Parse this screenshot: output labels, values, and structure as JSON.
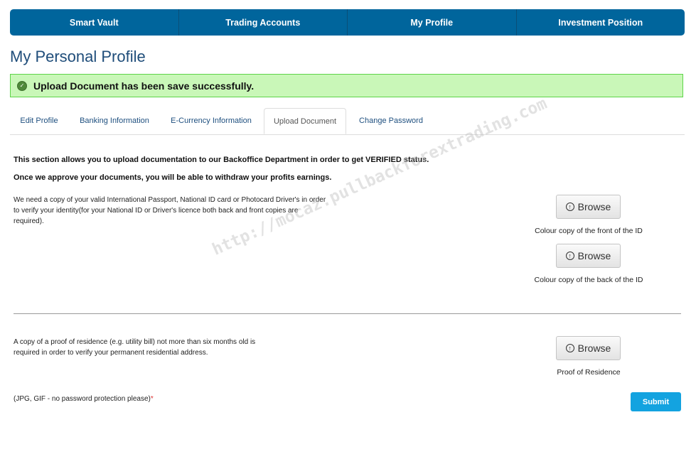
{
  "nav": {
    "items": [
      {
        "label": "Smart Vault"
      },
      {
        "label": "Trading Accounts"
      },
      {
        "label": "My Profile"
      },
      {
        "label": "Investment Position"
      }
    ]
  },
  "page": {
    "title": "My Personal Profile"
  },
  "alert": {
    "message": "Upload Document has been save successfully.",
    "icon": "check-circle-icon",
    "color": "#c9f7b8"
  },
  "tabs": [
    {
      "label": "Edit Profile"
    },
    {
      "label": "Banking Information"
    },
    {
      "label": "E-Currency Information"
    },
    {
      "label": "Upload Document",
      "active": true
    },
    {
      "label": "Change Password"
    }
  ],
  "content": {
    "intro_1": "This section allows you to upload documentation to our Backoffice Department in order to get VERIFIED status.",
    "intro_2": "Once we approve your documents, you will be able to withdraw your profits earnings.",
    "id_description": "We need a copy of your valid International Passport, National ID card or Photocard Driver's in order to verify your identity(for your National ID or Driver's licence both back and front copies are required).",
    "residence_description": "A copy of a proof of residence (e.g. utility bill) not more than six months old is required in order to verify your permanent residential address.",
    "browse_label": "Browse",
    "front_caption": "Colour copy of the front of the ID",
    "back_caption": "Colour copy of the back of the ID",
    "residence_caption": "Proof of Residence",
    "format_note": "(JPG, GIF - no password protection please)",
    "required_mark": "*",
    "submit_label": "Submit"
  },
  "watermark": "http://mocaz.pullbackforextrading.com",
  "colors": {
    "nav_bg": "#00659c",
    "submit_bg": "#13a3e0",
    "title": "#1f4d7a"
  }
}
